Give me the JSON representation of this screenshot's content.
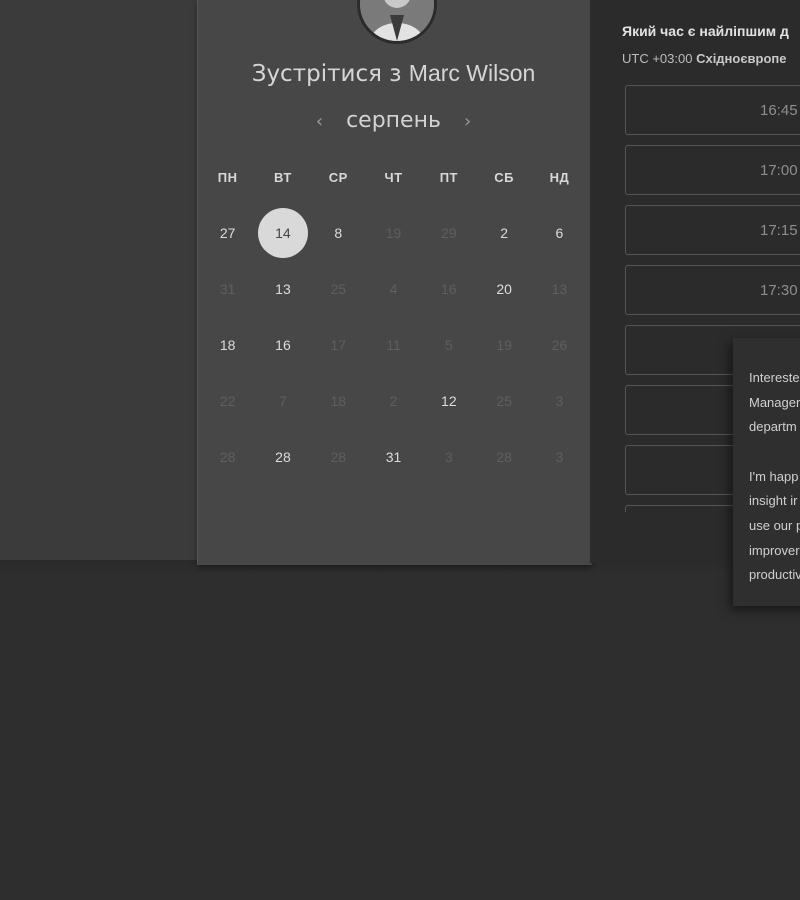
{
  "header": {
    "title_prefix": "Зустрітися з",
    "host_name": "Marc Wilson"
  },
  "calendar": {
    "month": "серпень",
    "prev_icon": "‹",
    "next_icon": "›",
    "weekdays": [
      "ПН",
      "ВТ",
      "СР",
      "ЧТ",
      "ПТ",
      "СБ",
      "НД"
    ],
    "weeks": [
      [
        {
          "d": "27",
          "a": true
        },
        {
          "d": "14",
          "a": true,
          "sel": true
        },
        {
          "d": "8",
          "a": true
        },
        {
          "d": "19",
          "a": false
        },
        {
          "d": "29",
          "a": false
        },
        {
          "d": "2",
          "a": true
        },
        {
          "d": "6",
          "a": true
        }
      ],
      [
        {
          "d": "31",
          "a": false
        },
        {
          "d": "13",
          "a": true
        },
        {
          "d": "25",
          "a": false
        },
        {
          "d": "4",
          "a": false
        },
        {
          "d": "16",
          "a": false
        },
        {
          "d": "20",
          "a": true
        },
        {
          "d": "13",
          "a": false
        }
      ],
      [
        {
          "d": "18",
          "a": true
        },
        {
          "d": "16",
          "a": true
        },
        {
          "d": "17",
          "a": false
        },
        {
          "d": "11",
          "a": false
        },
        {
          "d": "5",
          "a": false
        },
        {
          "d": "19",
          "a": false
        },
        {
          "d": "26",
          "a": false
        }
      ],
      [
        {
          "d": "22",
          "a": false
        },
        {
          "d": "7",
          "a": false
        },
        {
          "d": "18",
          "a": false
        },
        {
          "d": "2",
          "a": false
        },
        {
          "d": "12",
          "a": true
        },
        {
          "d": "25",
          "a": false
        },
        {
          "d": "3",
          "a": false
        }
      ],
      [
        {
          "d": "28",
          "a": false
        },
        {
          "d": "28",
          "a": true
        },
        {
          "d": "28",
          "a": false
        },
        {
          "d": "31",
          "a": true
        },
        {
          "d": "3",
          "a": false
        },
        {
          "d": "28",
          "a": false
        },
        {
          "d": "3",
          "a": false
        }
      ]
    ]
  },
  "time_panel": {
    "question": "Який час є найліпшим д",
    "tz_offset": "UTC +03:00",
    "tz_name": "Східноєвропе",
    "slots": [
      "16:45",
      "17:00",
      "17:15",
      "17:30",
      "",
      "",
      "",
      ""
    ]
  },
  "tooltip": {
    "lines1": [
      "Intereste",
      "Manager",
      "departm"
    ],
    "lines2": [
      "I'm happ",
      "insight ir",
      "use our p",
      "improver",
      "productiv"
    ]
  }
}
